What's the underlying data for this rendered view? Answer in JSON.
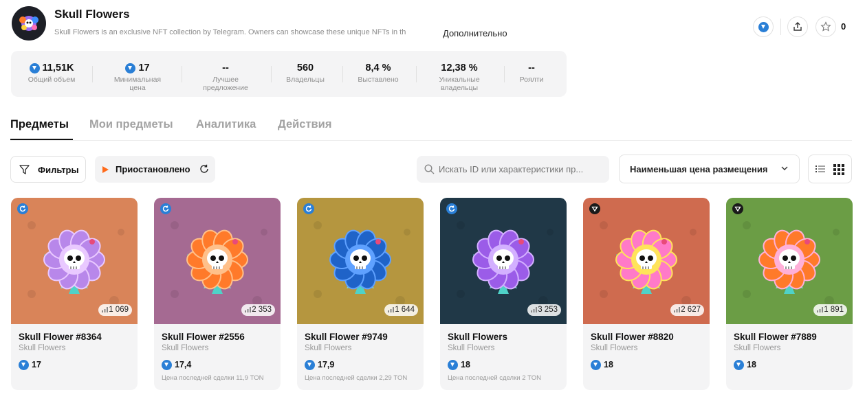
{
  "collection": {
    "title": "Skull Flowers",
    "description": "Skull Flowers is an exclusive NFT collection by Telegram. Owners can showcase these unique NFTs in th",
    "more_label": "Дополнительно",
    "favorites_count": "0"
  },
  "stats": [
    {
      "value": "11,51K",
      "label": "Общий объем",
      "ton": true
    },
    {
      "value": "17",
      "label": "Минимальная цена",
      "ton": true
    },
    {
      "value": "--",
      "label": "Лучшее предложение",
      "ton": false
    },
    {
      "value": "560",
      "label": "Владельцы",
      "ton": false
    },
    {
      "value": "8,4 %",
      "label": "Выставлено",
      "ton": false
    },
    {
      "value": "12,38 %",
      "label": "Уникальные владельцы",
      "ton": false
    },
    {
      "value": "--",
      "label": "Роялти",
      "ton": false
    }
  ],
  "tabs": [
    {
      "label": "Предметы",
      "active": true
    },
    {
      "label": "Мои предметы",
      "active": false
    },
    {
      "label": "Аналитика",
      "active": false
    },
    {
      "label": "Действия",
      "active": false
    }
  ],
  "toolbar": {
    "filters_label": "Фильтры",
    "paused_label": "Приостановлено",
    "search_placeholder": "Искать ID или характеристики пр...",
    "sort_label": "Наименьшая цена размещения"
  },
  "colors": {
    "ton_blue": "#2a7fd6",
    "accent_orange": "#ff6a1a"
  },
  "items": [
    {
      "name": "Skull Flower #8364",
      "collection": "Skull Flowers",
      "price": "17",
      "views": "1 069",
      "last_sale": "",
      "badge": "refresh-badge",
      "bg": "#d98459",
      "petal": "#b887ea",
      "petal2": "#e9c9ff"
    },
    {
      "name": "Skull Flower #2556",
      "collection": "Skull Flowers",
      "price": "17,4",
      "views": "2 353",
      "last_sale": "Цена последней сделки 11,9 TON",
      "badge": "refresh-badge",
      "bg": "#a56a92",
      "petal": "#ff7a2a",
      "petal2": "#ffc08a"
    },
    {
      "name": "Skull Flower #9749",
      "collection": "Skull Flowers",
      "price": "17,9",
      "views": "1 644",
      "last_sale": "Цена последней сделки 2,29 TON",
      "badge": "refresh-badge",
      "bg": "#b5963f",
      "petal": "#1f63c8",
      "petal2": "#5fa1ff"
    },
    {
      "name": "Skull Flowers",
      "collection": "Skull Flowers",
      "price": "18",
      "views": "3 253",
      "last_sale": "Цена последней сделки 2 TON",
      "badge": "refresh-badge",
      "bg": "#203847",
      "petal": "#9b5ce8",
      "petal2": "#d3b0ff"
    },
    {
      "name": "Skull Flower #8820",
      "collection": "Skull Flowers",
      "price": "18",
      "views": "2 627",
      "last_sale": "",
      "badge": "ton-badge",
      "bg": "#cf6b4f",
      "petal": "#ff7ac8",
      "petal2": "#ffe35a"
    },
    {
      "name": "Skull Flower #7889",
      "collection": "Skull Flowers",
      "price": "18",
      "views": "1 891",
      "last_sale": "",
      "badge": "ton-badge",
      "bg": "#6b9d45",
      "petal": "#ff7a2a",
      "petal2": "#ffb0d8"
    }
  ]
}
